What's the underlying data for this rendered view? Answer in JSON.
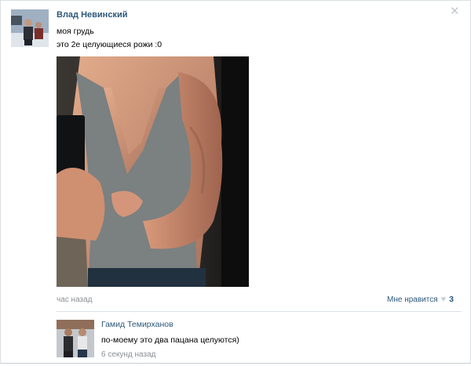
{
  "post": {
    "author": "Влад Невинский",
    "lines": [
      "моя грудь",
      "это 2е целующиеся рожи :0"
    ],
    "timestamp": "час назад",
    "like_label": "Мне нравится",
    "like_count": "3"
  },
  "comment": {
    "author": "Гамид Темирханов",
    "text": "по-моему это два пацана целуются)",
    "timestamp": "6 секунд назад"
  },
  "icons": {
    "close": "close-icon",
    "like": "heart-icon"
  },
  "colors": {
    "link": "#2b587a",
    "muted": "#8a8f94",
    "divider": "#dae2e8"
  }
}
